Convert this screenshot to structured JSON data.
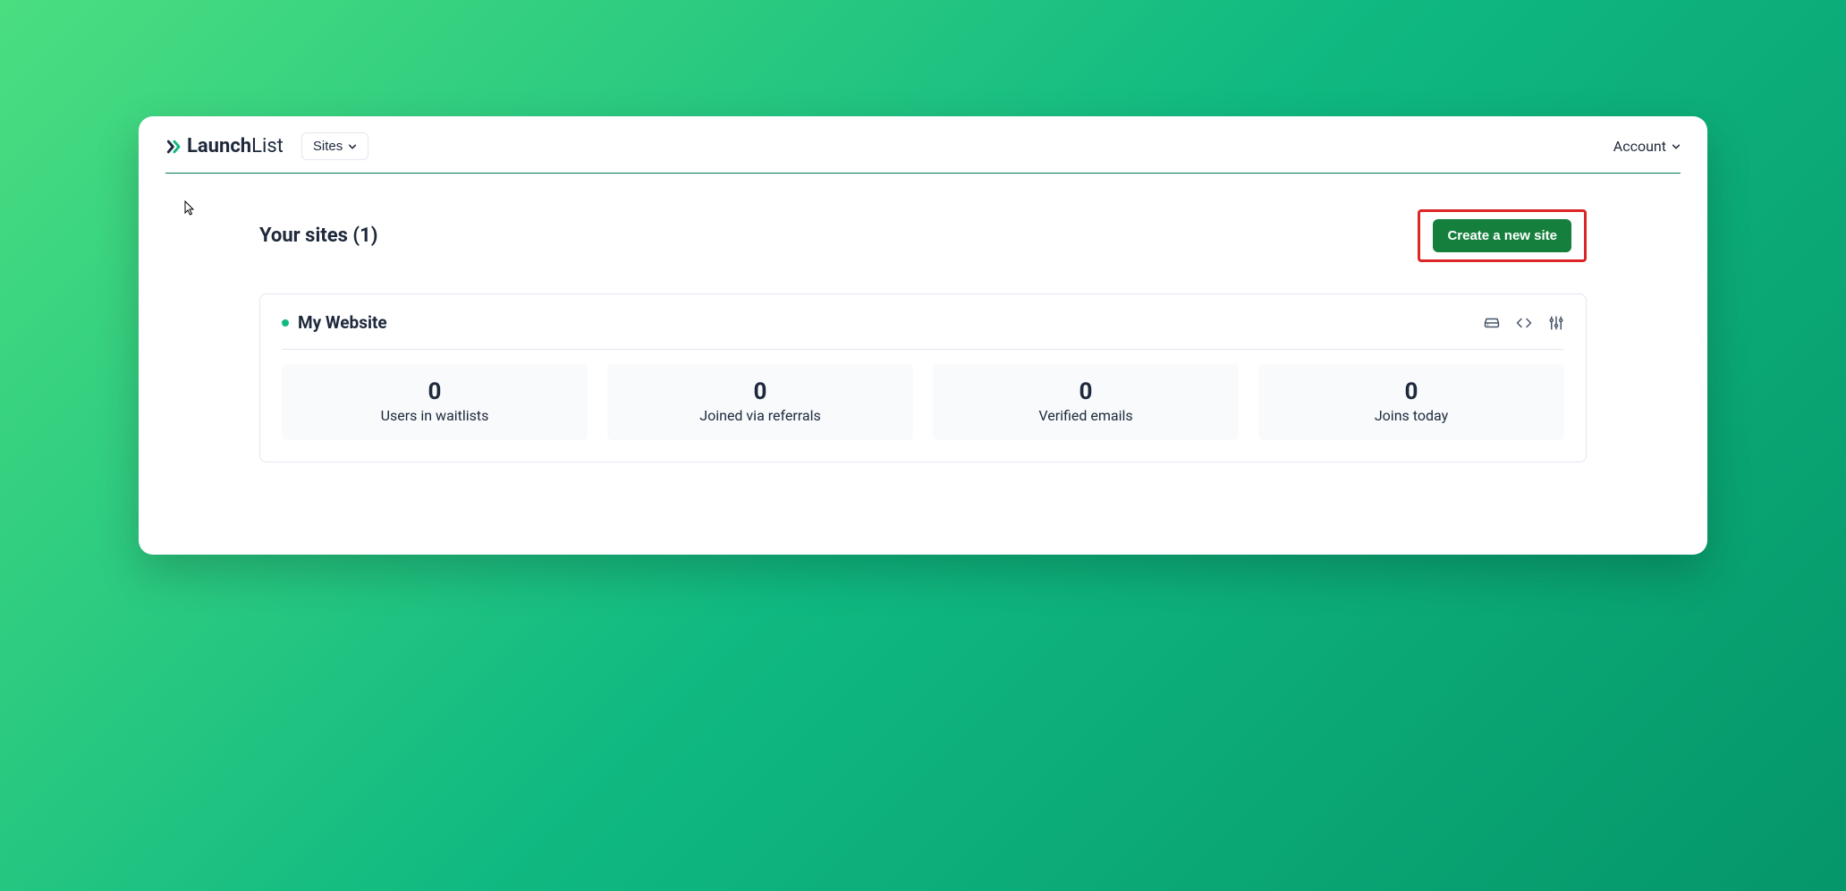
{
  "logo": {
    "bold": "Launch",
    "light": "List"
  },
  "nav": {
    "sites_label": "Sites",
    "account_label": "Account"
  },
  "page": {
    "title": "Your sites (1)",
    "create_button": "Create a new site"
  },
  "site": {
    "name": "My Website",
    "stats": [
      {
        "value": "0",
        "label": "Users in waitlists"
      },
      {
        "value": "0",
        "label": "Joined via referrals"
      },
      {
        "value": "0",
        "label": "Verified emails"
      },
      {
        "value": "0",
        "label": "Joins today"
      }
    ]
  }
}
